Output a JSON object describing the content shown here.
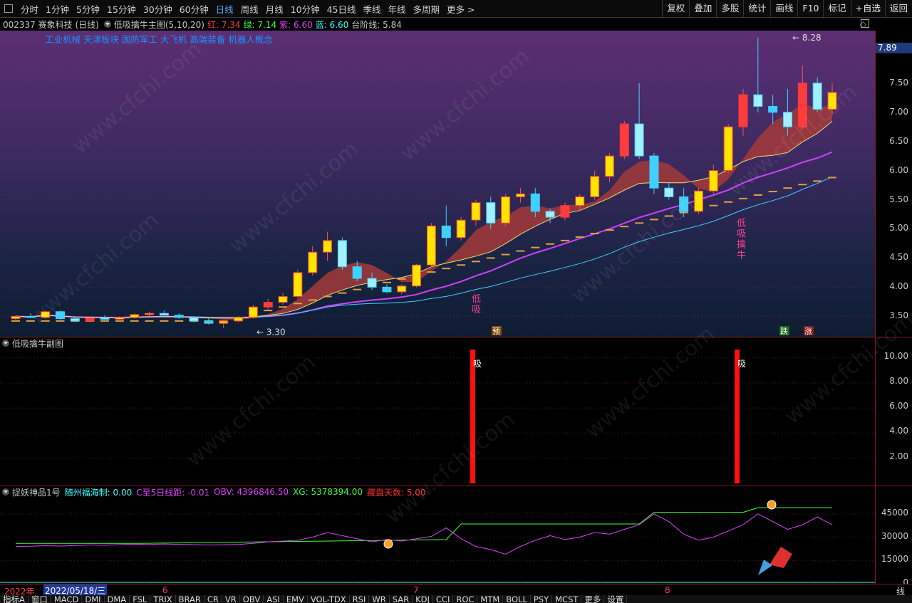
{
  "toolbar": {
    "periods": [
      "分时",
      "1分钟",
      "5分钟",
      "15分钟",
      "30分钟",
      "60分钟",
      "日线",
      "周线",
      "月线",
      "10分钟",
      "45日线",
      "季线",
      "年线",
      "多周期",
      "更多 >"
    ],
    "active_period": "日线",
    "right_buttons": [
      "复权",
      "叠加",
      "多股",
      "统计",
      "画线",
      "F10",
      "标记",
      "+自选",
      "返回"
    ]
  },
  "info": {
    "code_name": "002337 赛象科技 (日线)",
    "formula": "低吸擒牛主图(5,10,20)",
    "red_label": "红: 7.34",
    "green_label": "绿: 7.14",
    "purple_label": "紫: 6.60",
    "blue_label": "蓝: 6.60",
    "step_label": "台阶线: 5.84"
  },
  "colors": {
    "red": "#ff3b3b",
    "green": "#3cff3c",
    "purple": "#d040ff",
    "blue": "#40d0ff",
    "yellow": "#ffe400",
    "cyan": "#00e5ff"
  },
  "main": {
    "concepts": "工业机械 天津板块 国防军工 大飞机 高端装备 机器人概念",
    "high_label": "8.28",
    "low_label": "3.30",
    "last_price": "7.89",
    "y_ticks": [
      "7.50",
      "7.00",
      "6.50",
      "6.00",
      "5.50",
      "5.00",
      "4.50",
      "4.00",
      "3.50"
    ],
    "signal_low1": [
      "低",
      "吸"
    ],
    "signal_low2": [
      "低",
      "吸",
      "擒",
      "牛"
    ],
    "marker_yu": "预",
    "marker_die": "跌",
    "marker_zhang": "涨"
  },
  "sub1": {
    "title": "低吸擒牛副图",
    "y_ticks": [
      "10.00",
      "8.00",
      "6.00",
      "4.00",
      "2.00"
    ],
    "signal_label": "吸"
  },
  "sub2": {
    "title": "捉妖神品1号",
    "v1_label": "随州福海制: 0.00",
    "v2_label": "C至5日线距: -0.01",
    "obv_label": "OBV: 4396846.50",
    "xg_label": "XG: 5378394.00",
    "days_label": "藏盘天数: 5.00",
    "y_ticks": [
      "45000",
      "30000",
      "15000",
      "0"
    ]
  },
  "dates": {
    "year": "2022年",
    "cursor_date": "2022/05/18/三",
    "m6": "6",
    "m7": "7",
    "m8": "8",
    "tail": "线"
  },
  "tabs": [
    "指标A",
    "窗口",
    "MACD",
    "DMI",
    "DMA",
    "FSL",
    "TRIX",
    "BRAR",
    "CR",
    "VR",
    "OBV",
    "ASI",
    "EMV",
    "VOL-TDX",
    "RSI",
    "WR",
    "SAR",
    "KDJ",
    "CCI",
    "ROC",
    "MTM",
    "BOLL",
    "PSY",
    "MCST",
    "更多",
    "设置"
  ],
  "chart_data": {
    "type": "candlestick",
    "ohlc": [
      [
        3.46,
        3.52,
        3.44,
        3.5
      ],
      [
        3.5,
        3.55,
        3.47,
        3.48
      ],
      [
        3.48,
        3.6,
        3.46,
        3.58
      ],
      [
        3.58,
        3.6,
        3.44,
        3.46
      ],
      [
        3.46,
        3.48,
        3.4,
        3.42
      ],
      [
        3.42,
        3.5,
        3.4,
        3.47
      ],
      [
        3.47,
        3.52,
        3.44,
        3.45
      ],
      [
        3.45,
        3.5,
        3.42,
        3.48
      ],
      [
        3.48,
        3.55,
        3.46,
        3.53
      ],
      [
        3.53,
        3.58,
        3.5,
        3.55
      ],
      [
        3.55,
        3.6,
        3.52,
        3.52
      ],
      [
        3.52,
        3.55,
        3.46,
        3.48
      ],
      [
        3.48,
        3.5,
        3.4,
        3.42
      ],
      [
        3.42,
        3.46,
        3.36,
        3.38
      ],
      [
        3.38,
        3.44,
        3.3,
        3.42
      ],
      [
        3.42,
        3.5,
        3.4,
        3.48
      ],
      [
        3.48,
        3.7,
        3.46,
        3.66
      ],
      [
        3.66,
        3.8,
        3.6,
        3.74
      ],
      [
        3.74,
        3.9,
        3.7,
        3.84
      ],
      [
        3.84,
        4.3,
        3.8,
        4.25
      ],
      [
        4.25,
        4.7,
        4.2,
        4.6
      ],
      [
        4.6,
        4.95,
        4.45,
        4.8
      ],
      [
        4.8,
        4.85,
        4.3,
        4.35
      ],
      [
        4.35,
        4.45,
        4.1,
        4.15
      ],
      [
        4.15,
        4.25,
        3.95,
        4.0
      ],
      [
        4.0,
        4.05,
        3.9,
        3.92
      ],
      [
        3.92,
        4.05,
        3.88,
        4.02
      ],
      [
        4.02,
        4.4,
        4.0,
        4.38
      ],
      [
        4.38,
        5.1,
        4.35,
        5.05
      ],
      [
        5.05,
        5.4,
        4.7,
        4.85
      ],
      [
        4.85,
        5.2,
        4.8,
        5.15
      ],
      [
        5.15,
        5.5,
        5.05,
        5.45
      ],
      [
        5.45,
        5.55,
        5.0,
        5.1
      ],
      [
        5.1,
        5.6,
        5.05,
        5.55
      ],
      [
        5.55,
        5.7,
        5.45,
        5.6
      ],
      [
        5.6,
        5.7,
        5.2,
        5.3
      ],
      [
        5.3,
        5.35,
        5.1,
        5.2
      ],
      [
        5.2,
        5.45,
        5.15,
        5.4
      ],
      [
        5.4,
        5.6,
        5.3,
        5.55
      ],
      [
        5.55,
        6.0,
        5.5,
        5.9
      ],
      [
        5.9,
        6.3,
        5.8,
        6.25
      ],
      [
        6.25,
        6.85,
        6.2,
        6.8
      ],
      [
        6.8,
        7.5,
        6.2,
        6.25
      ],
      [
        6.25,
        6.3,
        5.6,
        5.7
      ],
      [
        5.7,
        5.8,
        5.5,
        5.55
      ],
      [
        5.55,
        5.7,
        5.2,
        5.3
      ],
      [
        5.3,
        5.7,
        5.25,
        5.65
      ],
      [
        5.65,
        6.1,
        5.6,
        6.0
      ],
      [
        6.0,
        6.8,
        5.95,
        6.75
      ],
      [
        6.75,
        7.4,
        6.6,
        7.3
      ],
      [
        7.3,
        8.28,
        7.0,
        7.1
      ],
      [
        7.1,
        7.3,
        6.8,
        7.0
      ],
      [
        7.0,
        7.4,
        6.6,
        6.75
      ],
      [
        6.75,
        7.8,
        6.7,
        7.5
      ],
      [
        7.5,
        7.6,
        7.0,
        7.05
      ],
      [
        7.05,
        7.5,
        6.95,
        7.34
      ]
    ]
  }
}
